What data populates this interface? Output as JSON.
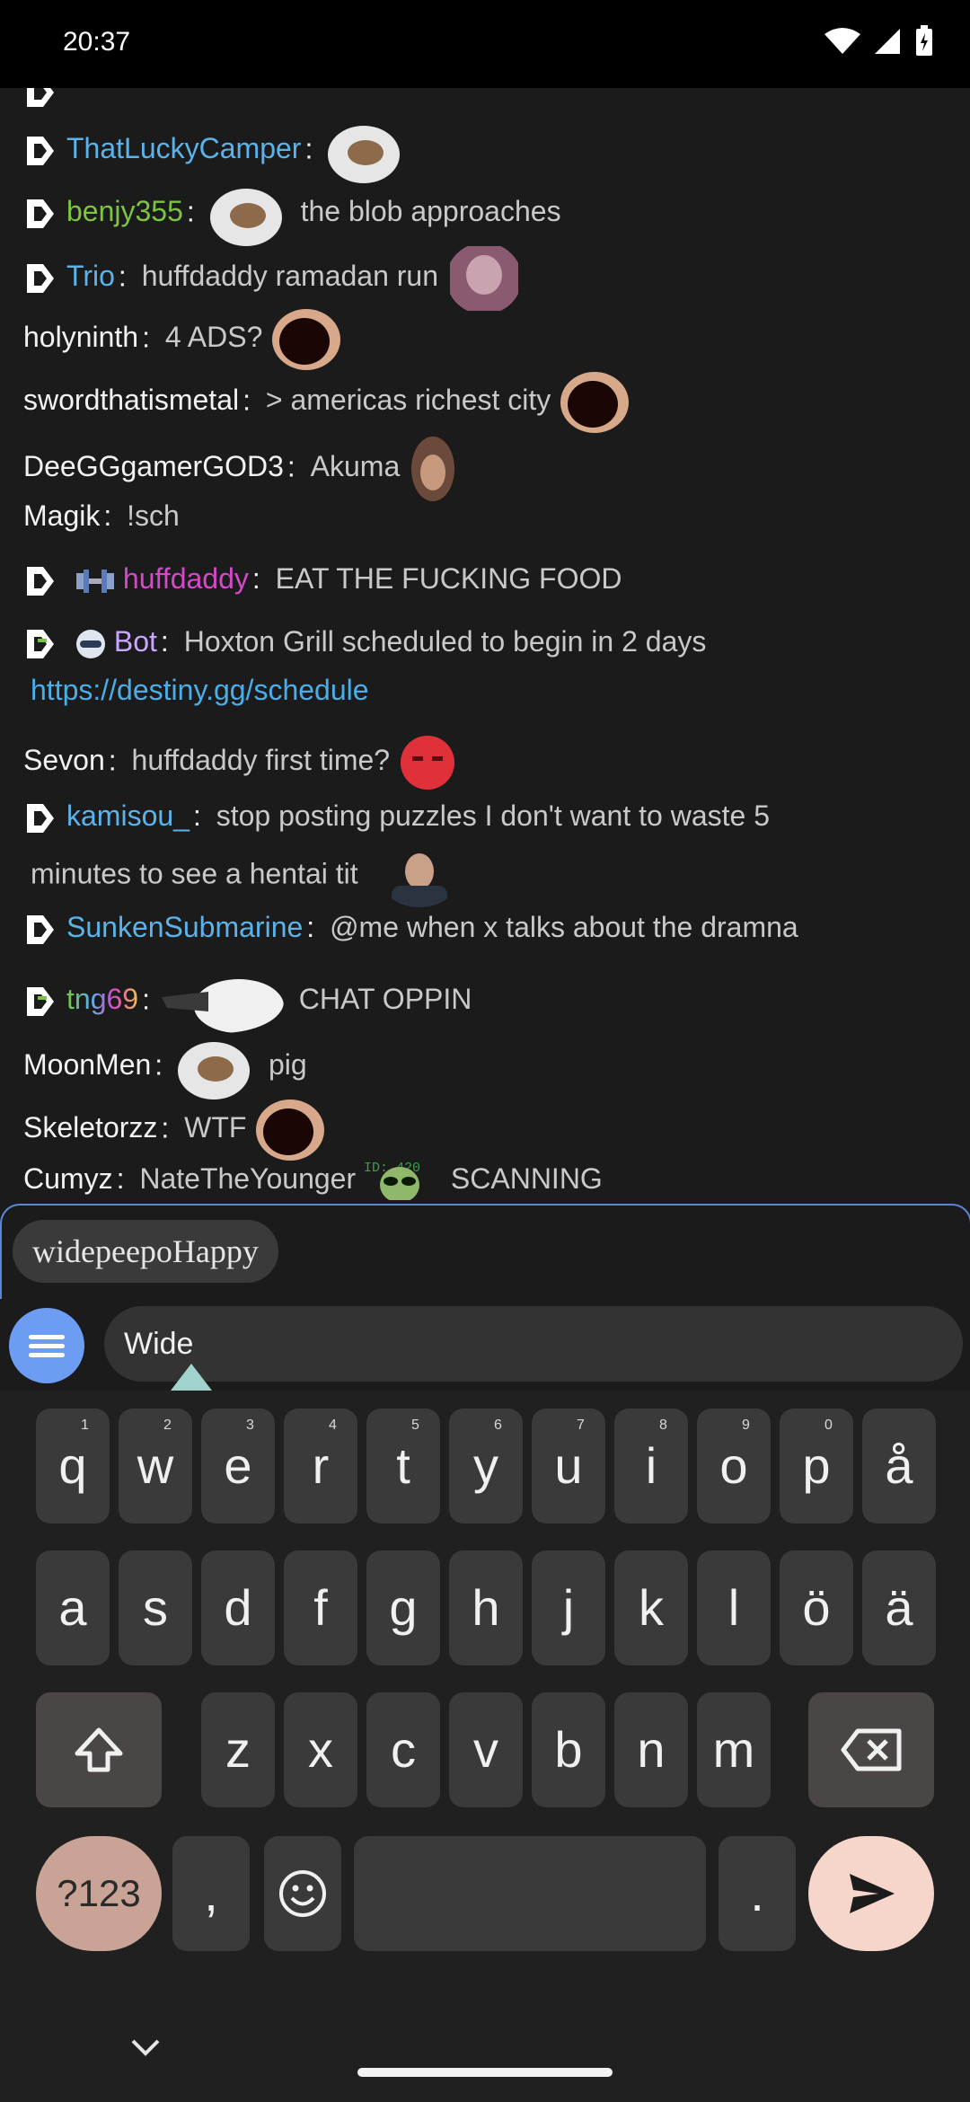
{
  "status": {
    "time": "20:37"
  },
  "chat": {
    "messages": [
      {
        "user": "ThatLuckyCamper",
        "text": ""
      },
      {
        "user": "benjy355",
        "text": "the blob approaches"
      },
      {
        "user": "Trio",
        "text": "huffdaddy ramadan run"
      },
      {
        "user": "holyninth",
        "text": "4 ADS?"
      },
      {
        "user": "swordthatismetal",
        "text": "> americas richest city"
      },
      {
        "user": "DeeGGgamerGOD3",
        "text": "Akuma"
      },
      {
        "user": "Magik",
        "text": "!sch"
      },
      {
        "user": "huffdaddy",
        "text": "EAT THE FUCKING FOOD"
      },
      {
        "user": "Bot",
        "text": "Hoxton Grill scheduled to begin in 2 days",
        "link": "https://destiny.gg/schedule"
      },
      {
        "user": "Sevon",
        "text": "huffdaddy first time?"
      },
      {
        "user": "kamisou_",
        "text": "stop posting puzzles I don't want to waste 5",
        "text2": "minutes to see a hentai tit"
      },
      {
        "user": "SunkenSubmarine",
        "text": "@me when x talks about the dramna"
      },
      {
        "user": "tng69",
        "text": "CHAT OPPIN"
      },
      {
        "user": "MoonMen",
        "text": "pig"
      },
      {
        "user": "Skeletorzz",
        "text": "WTF"
      },
      {
        "user": "Cumyz",
        "text": "NateTheYounger",
        "text2": "SCANNING",
        "overlay": "ID: 420"
      }
    ]
  },
  "suggestion": {
    "label": "widepeepoHappy"
  },
  "input": {
    "value": "Wide"
  },
  "keyboard": {
    "row1": [
      {
        "k": "q",
        "n": "1"
      },
      {
        "k": "w",
        "n": "2"
      },
      {
        "k": "e",
        "n": "3"
      },
      {
        "k": "r",
        "n": "4"
      },
      {
        "k": "t",
        "n": "5"
      },
      {
        "k": "y",
        "n": "6"
      },
      {
        "k": "u",
        "n": "7"
      },
      {
        "k": "i",
        "n": "8"
      },
      {
        "k": "o",
        "n": "9"
      },
      {
        "k": "p",
        "n": "0"
      },
      {
        "k": "å",
        "n": ""
      }
    ],
    "row2": [
      "a",
      "s",
      "d",
      "f",
      "g",
      "h",
      "j",
      "k",
      "l",
      "ö",
      "ä"
    ],
    "row3": [
      "z",
      "x",
      "c",
      "v",
      "b",
      "n",
      "m"
    ],
    "sym_label": "?123",
    "comma": ",",
    "period": "."
  },
  "colors": {
    "accent": "#6c9df3",
    "panel_border": "#5a86d6",
    "send_key": "#f6d6cb",
    "sym_key": "#c9a396"
  }
}
